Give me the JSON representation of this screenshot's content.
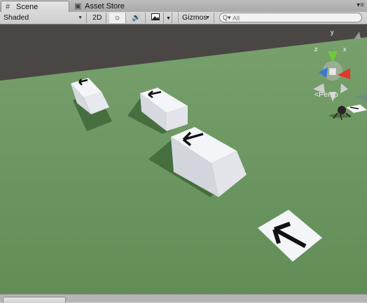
{
  "tabs": [
    {
      "label": "Scene",
      "icon": "grid-icon",
      "active": true
    },
    {
      "label": "Asset Store",
      "icon": "store-bag-icon",
      "active": false
    }
  ],
  "toolbar": {
    "shading_mode": "Shaded",
    "mode_2d": "2D",
    "lighting_icon": "sun-icon",
    "audio_icon": "speaker-icon",
    "effects_icon": "image-icon",
    "gizmos_label": "Gizmos",
    "search_placeholder": "All"
  },
  "viewport": {
    "projection_label": "Persp",
    "gizmo_axes": {
      "y": "y",
      "z": "z",
      "x": "x"
    },
    "colors": {
      "sky": "#4a4644",
      "ground": "#6e9a63",
      "axis_y": "#6fcb3a",
      "axis_z": "#3a78d6",
      "axis_x": "#e0392d"
    }
  }
}
